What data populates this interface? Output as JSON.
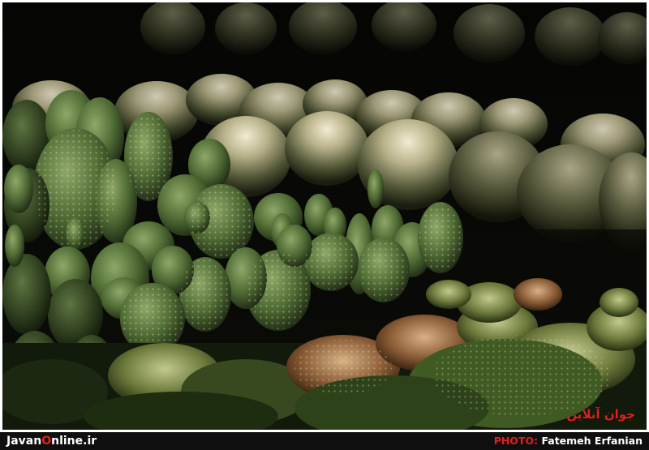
{
  "watermark": {
    "logo_text": "جوان آنلاین"
  },
  "footer": {
    "site_part1": "Javan",
    "site_o": "O",
    "site_part2": "nline.ir",
    "photo_label": "PHOTO:",
    "photographer": "Fatemeh Erfanian"
  },
  "colors": {
    "accent": "#e0201c",
    "bar": "#0f0f0f",
    "text": "#ffffff"
  }
}
